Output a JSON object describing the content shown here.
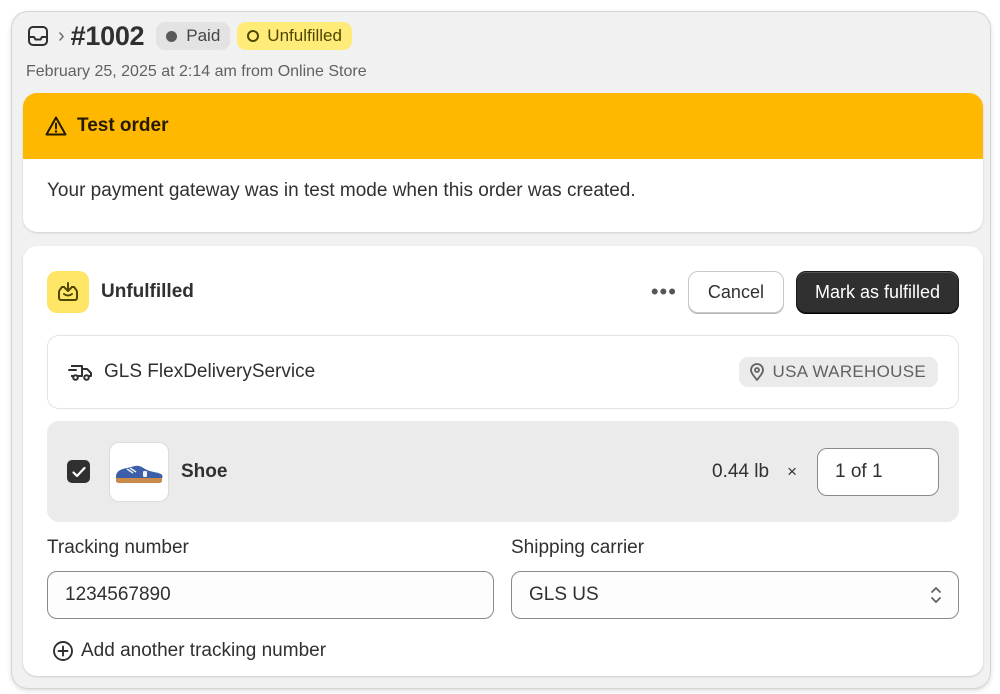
{
  "header": {
    "order_number": "#1002",
    "badge_paid": "Paid",
    "badge_unfulfilled": "Unfulfilled",
    "subtitle": "February 25, 2025 at 2:14 am from Online Store"
  },
  "test_banner": {
    "title": "Test order",
    "message": "Your payment gateway was in test mode when this order was created.",
    "color": "#ffb800"
  },
  "fulfillment": {
    "status_title": "Unfulfilled",
    "more_label": "•••",
    "cancel_label": "Cancel",
    "primary_label": "Mark as fulfilled",
    "carrier_service": "GLS FlexDeliveryService",
    "location": "USA WAREHOUSE",
    "item": {
      "name": "Shoe",
      "weight": "0.44 lb",
      "times": "×",
      "quantity": "1 of 1",
      "checked": true
    },
    "tracking_label": "Tracking number",
    "tracking_value": "1234567890",
    "carrier_label": "Shipping carrier",
    "carrier_value": "GLS US",
    "add_tracking": "Add another tracking number"
  },
  "icons": {
    "orders": "inbox-icon",
    "breadcrumb": "chevron-right-icon",
    "warning": "warning-triangle-icon",
    "fulfillment": "package-icon",
    "truck": "truck-icon",
    "location": "location-pin-icon",
    "checkbox": "checkmark-icon",
    "select": "select-chevrons-icon",
    "add": "plus-circle-icon"
  }
}
